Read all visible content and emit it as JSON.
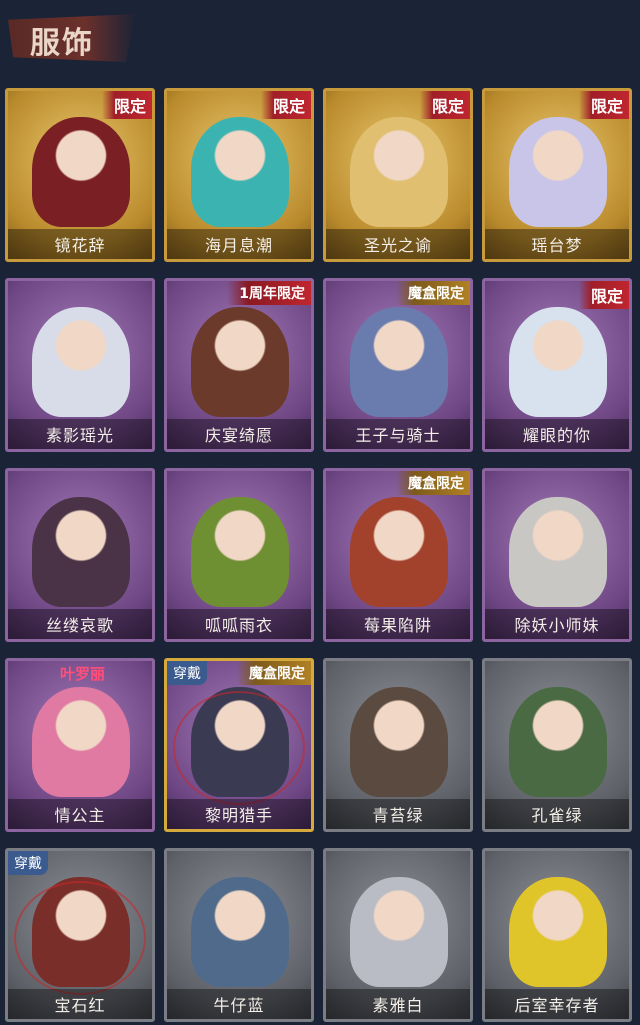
{
  "header": {
    "title": "服饰"
  },
  "colors": {
    "background": "#1b2336",
    "gold": "#c79a3c",
    "purple": "#8b64a0",
    "grey": "#7a7d84",
    "tag_red": "#c0262f",
    "wearing_blue": "#3b5b8f"
  },
  "costumes": [
    {
      "name": "镜花辞",
      "tier": "gold",
      "tag": "限定",
      "portrait": "#7a1f24"
    },
    {
      "name": "海月息潮",
      "tier": "gold",
      "tag": "限定",
      "portrait": "#3bb3b0"
    },
    {
      "name": "圣光之谕",
      "tier": "gold",
      "tag": "限定",
      "portrait": "#e0c070"
    },
    {
      "name": "瑶台梦",
      "tier": "gold",
      "tag": "限定",
      "portrait": "#c8c5e8"
    },
    {
      "name": "素影瑶光",
      "tier": "purple",
      "tag": "",
      "portrait": "#d7dce8"
    },
    {
      "name": "庆宴绮愿",
      "tier": "purple",
      "tag": "1周年限定",
      "portrait": "#6b3a2b"
    },
    {
      "name": "王子与骑士",
      "tier": "purple",
      "tag": "魔盒限定",
      "portrait": "#6a7cae"
    },
    {
      "name": "耀眼的你",
      "tier": "purple",
      "tag": "限定",
      "portrait": "#d8e2ee"
    },
    {
      "name": "丝缕哀歌",
      "tier": "purple",
      "tag": "",
      "portrait": "#4a3346"
    },
    {
      "name": "呱呱雨衣",
      "tier": "purple",
      "tag": "",
      "portrait": "#6f8f33"
    },
    {
      "name": "莓果陷阱",
      "tier": "purple",
      "tag": "魔盒限定",
      "portrait": "#a2412c"
    },
    {
      "name": "除妖小师妹",
      "tier": "purple",
      "tag": "",
      "portrait": "#c9c7c4"
    },
    {
      "name": "情公主",
      "tier": "purple",
      "tag": "叶罗丽",
      "portrait": "#e07aa3"
    },
    {
      "name": "黎明猎手",
      "tier": "purple",
      "tag": "魔盒限定",
      "wearing": "穿戴",
      "portrait": "#3a3a52"
    },
    {
      "name": "青苔绿",
      "tier": "grey",
      "tag": "",
      "portrait": "#5a4a3f"
    },
    {
      "name": "孔雀绿",
      "tier": "grey",
      "tag": "",
      "portrait": "#4a6a44"
    },
    {
      "name": "宝石红",
      "tier": "grey",
      "tag": "",
      "wearing": "穿戴",
      "portrait": "#7a2e2a"
    },
    {
      "name": "牛仔蓝",
      "tier": "grey",
      "tag": "",
      "portrait": "#4f6a8a"
    },
    {
      "name": "素雅白",
      "tier": "grey",
      "tag": "",
      "portrait": "#b9bcc4"
    },
    {
      "name": "后室幸存者",
      "tier": "grey",
      "tag": "",
      "portrait": "#e0c52a"
    }
  ]
}
